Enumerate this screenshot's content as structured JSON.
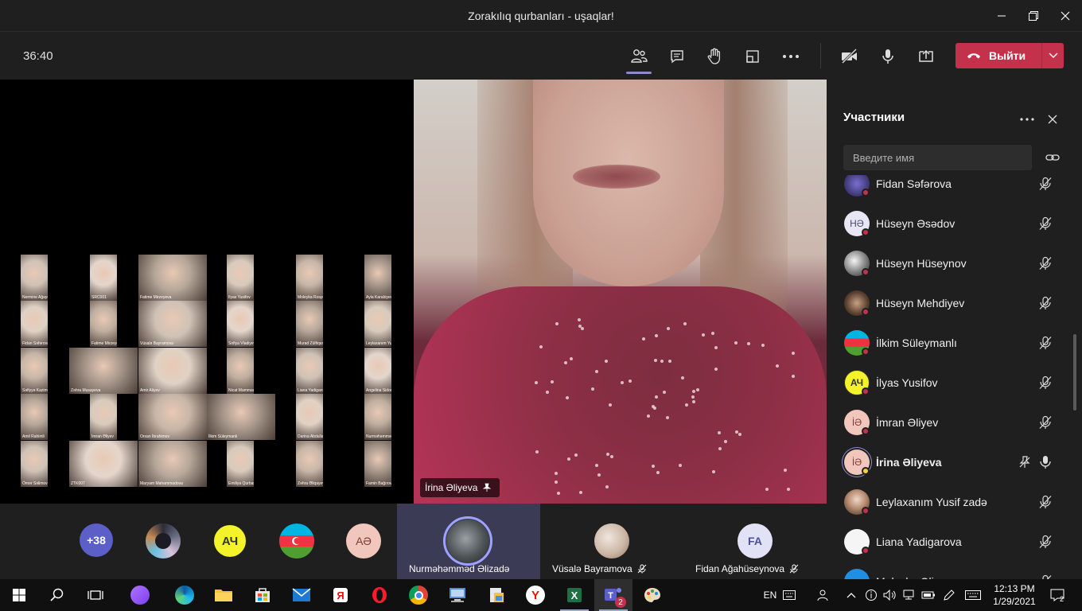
{
  "window": {
    "title": "Zorakılıq qurbanları - uşaqlar!"
  },
  "toolbar": {
    "timer": "36:40",
    "leave_label": "Выйти"
  },
  "gallery": {
    "captions": [
      "Nermine Ağayeva",
      "SRC001",
      "Fatime Mirzeyeva",
      "Ilyas Yusifov",
      "Moleyka Rzayeva",
      "Ayla Karabiyeva",
      "Fidan Səfərova",
      "Fatime Mirzeyeva",
      "Vüsalə Bayramova",
      "Sofiya Vladiyeva",
      "Murad Zülfiqarov",
      "Leylaxanım Yusif zadə",
      "Səfiyyə Kazimova",
      "Zəhra Musayeva",
      "Amir Aliyev",
      "Nicat Mammadov",
      "Liana Yadigarova",
      "Angelina Sidorova",
      "Amil Rahimli",
      "İmran Əliyev",
      "Orxan İbrahimov",
      "İlkim Süleymanlı",
      "Darina Abdullayeva",
      "Nurməhəmməd Əlizadə",
      "Ömər Səlimov",
      "ZTK007",
      "Maryam Mahammadova",
      "Emiliya Qurbanova",
      "Zəhra Əliqayeva",
      "Famin Bağırov"
    ]
  },
  "main_video": {
    "name": "İrina Əliyeva"
  },
  "panel": {
    "title": "Участники",
    "search_placeholder": "Введите имя",
    "participants": [
      {
        "name": "Fidan Səfərova",
        "initials": "",
        "mic": "off"
      },
      {
        "name": "Hüseyn Əsədov",
        "initials": "HƏ",
        "mic": "off"
      },
      {
        "name": "Hüseyn Hüseynov",
        "initials": "",
        "mic": "off"
      },
      {
        "name": "Hüseyn Mehdiyev",
        "initials": "",
        "mic": "off"
      },
      {
        "name": "İlkim Süleymanlı",
        "initials": "",
        "mic": "off"
      },
      {
        "name": "İlyas Yusifov",
        "initials": "АЧ",
        "mic": "off"
      },
      {
        "name": "İmran Əliyev",
        "initials": "İƏ",
        "mic": "off"
      },
      {
        "name": "İrina Əliyeva",
        "initials": "İƏ",
        "mic": "on"
      },
      {
        "name": "Leylaxanım Yusif zadə",
        "initials": "",
        "mic": "off"
      },
      {
        "name": "Liana Yadigarova",
        "initials": "",
        "mic": "off"
      },
      {
        "name": "Məleykə Əliyeva",
        "initials": "",
        "mic": "off"
      }
    ]
  },
  "strip": {
    "more_count": "+38",
    "tiles": [
      {
        "name": "Nurməhəmməd Əlizadə"
      },
      {
        "name": "Vüsalə Bayramova"
      },
      {
        "name": "Fidan Ağahüseynova",
        "initials": "FA"
      }
    ],
    "avatars": [
      {
        "initials": ""
      },
      {
        "initials": "АЧ"
      },
      {
        "initials": ""
      },
      {
        "initials": "AƏ"
      }
    ]
  },
  "taskbar": {
    "language": "EN",
    "time": "12:13 PM",
    "date": "1/29/2021",
    "teams_badge": "2",
    "notifications": "2"
  },
  "colors": {
    "accent": "#5b5fc7",
    "leave": "#c4314b",
    "panel_bg": "#1f1f1f",
    "status_busy": "#c4314b",
    "status_away": "#f8d22a"
  }
}
